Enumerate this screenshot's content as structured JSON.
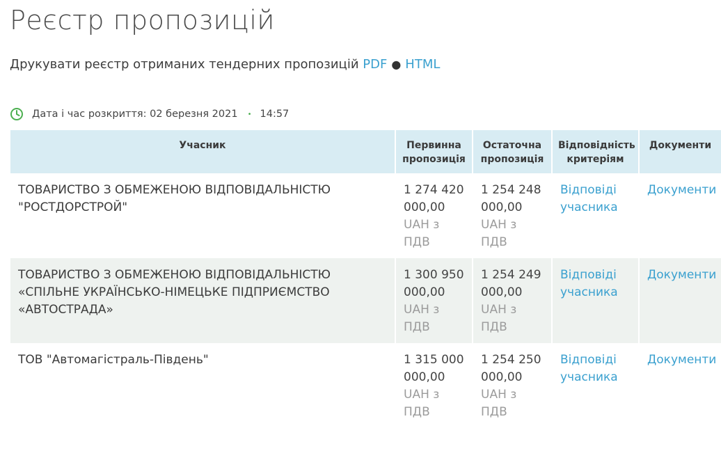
{
  "page": {
    "title": "Реєстр пропозицій"
  },
  "print": {
    "text": "Друкувати реєстр отриманих тендерних пропозицій",
    "pdf_label": "PDF",
    "separator": "●",
    "html_label": "HTML"
  },
  "opening": {
    "label": "Дата і час розкриття: 02 березня 2021",
    "separator": "•",
    "time": "14:57",
    "icon": "clock-icon",
    "icon_color": "#4caf50"
  },
  "table": {
    "headers": {
      "participant": "Учасник",
      "initial": "Первинна пропозиція",
      "final": "Остаточна пропозиція",
      "compliance": "Відповідність критеріям",
      "documents": "Документи"
    },
    "rows": [
      {
        "participant": "ТОВАРИСТВО З ОБМЕЖЕНОЮ ВІДПОВІДАЛЬНІСТЮ \"РОСТДОРСТРОЙ\"",
        "initial_amount": "1 274 420 000,00",
        "initial_currency": "UAH з ПДВ",
        "final_amount": "1 254 248 000,00",
        "final_currency": "UAH з ПДВ",
        "compliance_link": "Відповіді учасника",
        "documents_link": "Документи"
      },
      {
        "participant": "ТОВАРИСТВО З ОБМЕЖЕНОЮ ВІДПОВІДАЛЬНІСТЮ «СПІЛЬНЕ УКРАЇНСЬКО-НІМЕЦЬКЕ ПІДПРИЄМСТВО «АВТОСТРАДА»",
        "initial_amount": "1 300 950 000,00",
        "initial_currency": "UAH з ПДВ",
        "final_amount": "1 254 249 000,00",
        "final_currency": "UAH з ПДВ",
        "compliance_link": "Відповіді учасника",
        "documents_link": "Документи"
      },
      {
        "participant": "ТОВ \"Автомагістраль-Південь\"",
        "initial_amount": "1 315 000 000,00",
        "initial_currency": "UAH з ПДВ",
        "final_amount": "1 254 250 000,00",
        "final_currency": "UAH з ПДВ",
        "compliance_link": "Відповіді учасника",
        "documents_link": "Документи"
      }
    ]
  },
  "colors": {
    "link": "#3aa0cf",
    "header_bg": "#d8ecf3",
    "alt_row_bg": "#eef2ef",
    "currency_text": "#9b9b9b"
  }
}
